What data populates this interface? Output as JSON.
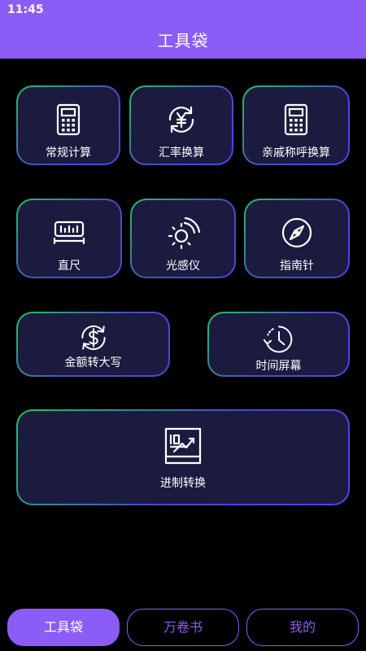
{
  "status_bar": {
    "time": "11:45"
  },
  "header": {
    "title": "工具袋"
  },
  "tools": [
    {
      "label": "常规计算",
      "icon": "calculator-icon"
    },
    {
      "label": "汇率换算",
      "icon": "currency-exchange-icon"
    },
    {
      "label": "亲戚称呼换算",
      "icon": "calculator-icon"
    },
    {
      "label": "直尺",
      "icon": "ruler-icon"
    },
    {
      "label": "光感仪",
      "icon": "light-sensor-icon"
    },
    {
      "label": "指南针",
      "icon": "compass-icon"
    },
    {
      "label": "金额转大写",
      "icon": "dollar-refresh-icon"
    },
    {
      "label": "时间屏幕",
      "icon": "clock-history-icon"
    },
    {
      "label": "进制转换",
      "icon": "base-convert-icon"
    }
  ],
  "tabs": [
    {
      "label": "工具袋",
      "active": true
    },
    {
      "label": "万卷书",
      "active": false
    },
    {
      "label": "我的",
      "active": false
    }
  ],
  "colors": {
    "accent": "#8b5cf6",
    "card_background": "#1b1b40",
    "border_green": "#22c55e",
    "border_blue": "#4f46e5"
  }
}
